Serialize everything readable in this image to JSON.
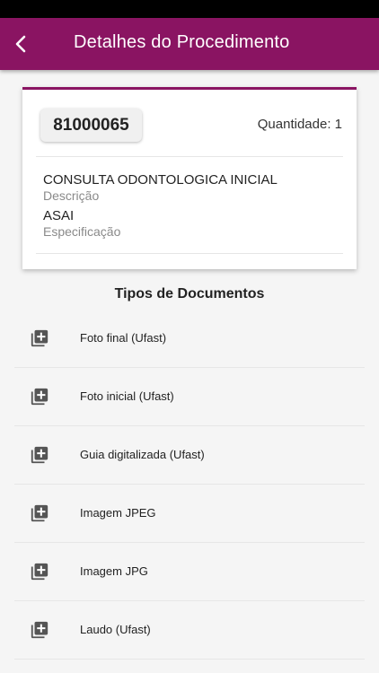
{
  "header": {
    "title": "Detalhes do Procedimento"
  },
  "procedure": {
    "code": "81000065",
    "quantity": "Quantidade: 1",
    "description_value": "CONSULTA ODONTOLOGICA INICIAL",
    "description_label": "Descrição",
    "specification_value": "ASAI",
    "specification_label": "Especificação"
  },
  "documents": {
    "title": "Tipos de Documentos",
    "items": [
      {
        "label": "Foto final (Ufast)",
        "icon": "add-to-library-icon"
      },
      {
        "label": "Foto inicial (Ufast)",
        "icon": "add-to-library-icon"
      },
      {
        "label": "Guia digitalizada (Ufast)",
        "icon": "add-to-library-icon"
      },
      {
        "label": "Imagem JPEG",
        "icon": "add-to-library-icon"
      },
      {
        "label": "Imagem JPG",
        "icon": "add-to-library-icon"
      },
      {
        "label": "Laudo (Ufast)",
        "icon": "add-to-library-icon"
      }
    ]
  },
  "colors": {
    "primary": "#8a1462",
    "background": "#f5f5f5",
    "icon": "#555555"
  }
}
